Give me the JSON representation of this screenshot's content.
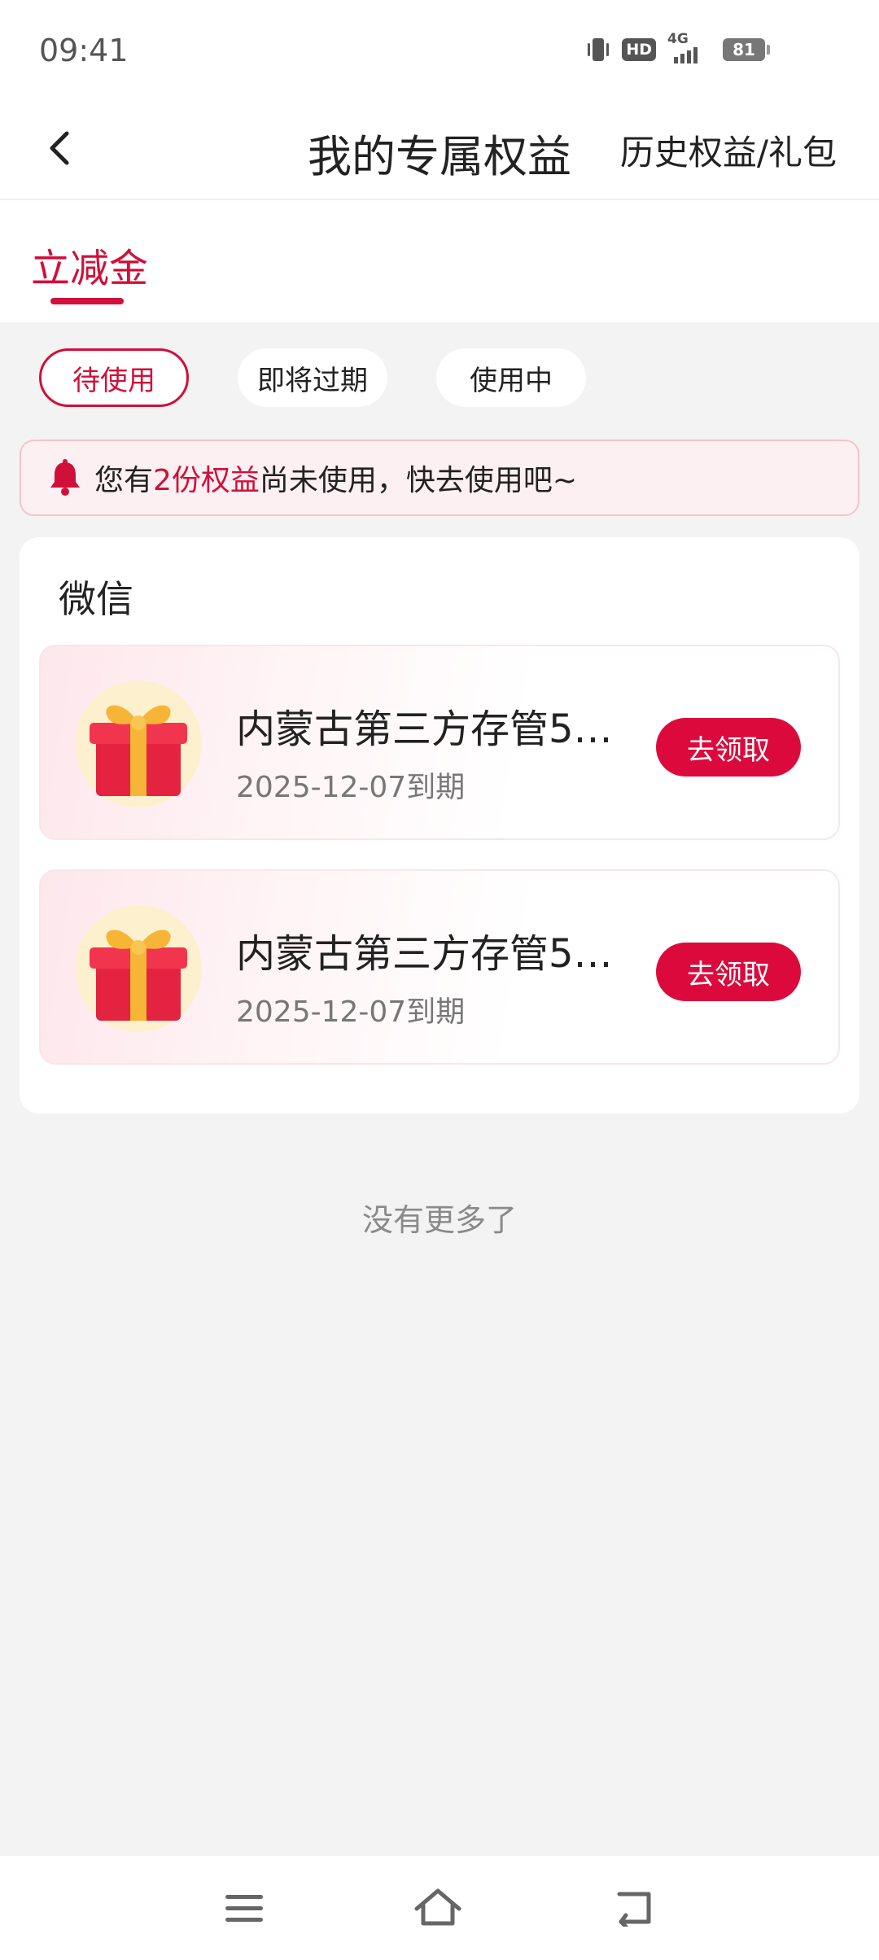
{
  "status_bar": {
    "time": "09:41",
    "hd_label": "HD",
    "network_label": "4G",
    "battery_level": "81"
  },
  "header": {
    "title": "我的专属权益",
    "history_link": "历史权益/礼包"
  },
  "tabs": {
    "active_label": "立减金"
  },
  "filters": [
    {
      "label": "待使用",
      "active": true
    },
    {
      "label": "即将过期",
      "active": false
    },
    {
      "label": "使用中",
      "active": false
    }
  ],
  "notice": {
    "prefix": "您有",
    "highlight": "2份权益",
    "suffix": "尚未使用，快去使用吧~"
  },
  "section": {
    "title": "微信",
    "items": [
      {
        "name": "内蒙古第三方存管5…",
        "expiry": "2025-12-07到期",
        "action": "去领取"
      },
      {
        "name": "内蒙古第三方存管5…",
        "expiry": "2025-12-07到期",
        "action": "去领取"
      }
    ]
  },
  "footer": {
    "no_more": "没有更多了"
  },
  "colors": {
    "accent": "#d0103a",
    "button": "#dc0a3c",
    "background": "#f3f3f3"
  }
}
